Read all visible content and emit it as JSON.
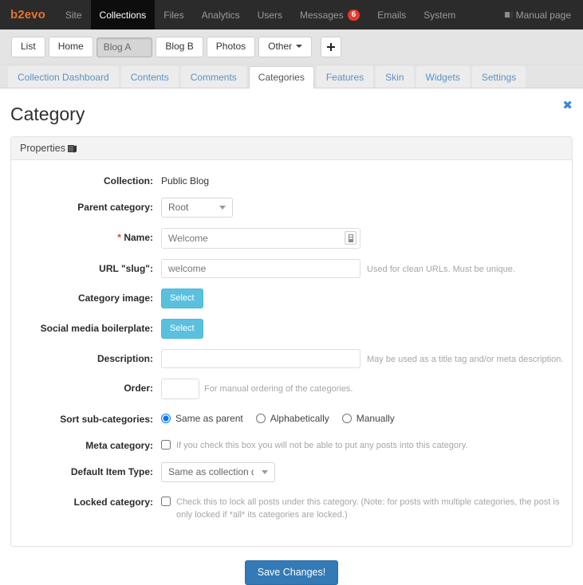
{
  "topnav": {
    "brand": "b2evo",
    "items": [
      {
        "label": "Site",
        "active": false
      },
      {
        "label": "Collections",
        "active": true
      },
      {
        "label": "Files",
        "active": false
      },
      {
        "label": "Analytics",
        "active": false
      },
      {
        "label": "Users",
        "active": false
      },
      {
        "label": "Messages",
        "active": false,
        "badge": "6"
      },
      {
        "label": "Emails",
        "active": false
      },
      {
        "label": "System",
        "active": false
      }
    ],
    "manual_label": "Manual page",
    "manual_icon": "book-icon",
    "badge_color": "#e8392f",
    "brand_color": "#e8722c",
    "background": "#2b2b2b"
  },
  "collection_bar": {
    "buttons": [
      {
        "label": "List",
        "selected": false
      },
      {
        "label": "Home",
        "selected": false
      },
      {
        "label": "Blog A",
        "selected": true
      },
      {
        "label": "Blog B",
        "selected": false
      },
      {
        "label": "Photos",
        "selected": false
      }
    ],
    "other_label": "Other",
    "add_icon": "plus-icon"
  },
  "subtabs": [
    {
      "label": "Collection Dashboard",
      "active": false
    },
    {
      "label": "Contents",
      "active": false
    },
    {
      "label": "Comments",
      "active": false
    },
    {
      "label": "Categories",
      "active": true
    },
    {
      "label": "Features",
      "active": false
    },
    {
      "label": "Skin",
      "active": false
    },
    {
      "label": "Widgets",
      "active": false
    },
    {
      "label": "Settings",
      "active": false
    }
  ],
  "page": {
    "title": "Category",
    "close_icon": "close-icon",
    "close_glyph": "✖",
    "panel_title": "Properties",
    "panel_icon": "book-icon"
  },
  "form": {
    "collection": {
      "label": "Collection:",
      "value": "Public Blog"
    },
    "parent_category": {
      "label": "Parent category:",
      "value": "Root",
      "options": [
        "Root"
      ]
    },
    "name": {
      "label": "Name:",
      "required_marker": "*",
      "value": "Welcome",
      "icon": "insert-field-icon"
    },
    "slug": {
      "label": "URL \"slug\":",
      "value": "welcome",
      "help": "Used for clean URLs. Must be unique."
    },
    "category_image": {
      "label": "Category image:",
      "button": "Select"
    },
    "social_media_boilerplate": {
      "label": "Social media boilerplate:",
      "button": "Select"
    },
    "description": {
      "label": "Description:",
      "value": "",
      "help": "May be used as a title tag and/or meta description."
    },
    "order": {
      "label": "Order:",
      "value": "",
      "help": "For manual ordering of the categories."
    },
    "sort_subcategories": {
      "label": "Sort sub-categories:",
      "options": [
        {
          "label": "Same as parent",
          "checked": true
        },
        {
          "label": "Alphabetically",
          "checked": false
        },
        {
          "label": "Manually",
          "checked": false
        }
      ]
    },
    "meta_category": {
      "label": "Meta category:",
      "checked": false,
      "help": "If you check this box you will not be able to put any posts into this category."
    },
    "default_item_type": {
      "label": "Default Item Type:",
      "value": "Same as collection default",
      "options": [
        "Same as collection default"
      ]
    },
    "locked_category": {
      "label": "Locked category:",
      "checked": false,
      "help": "Check this to lock all posts under this category. (Note: for posts with multiple categories, the post is only locked if *all* its categories are locked.)"
    },
    "save_button": "Save Changes!"
  },
  "colors": {
    "accent_blue": "#337ab7",
    "info_blue": "#5bc0de",
    "link_blue": "#5b92c7",
    "orange": "#e8722c",
    "red": "#e8392f"
  }
}
